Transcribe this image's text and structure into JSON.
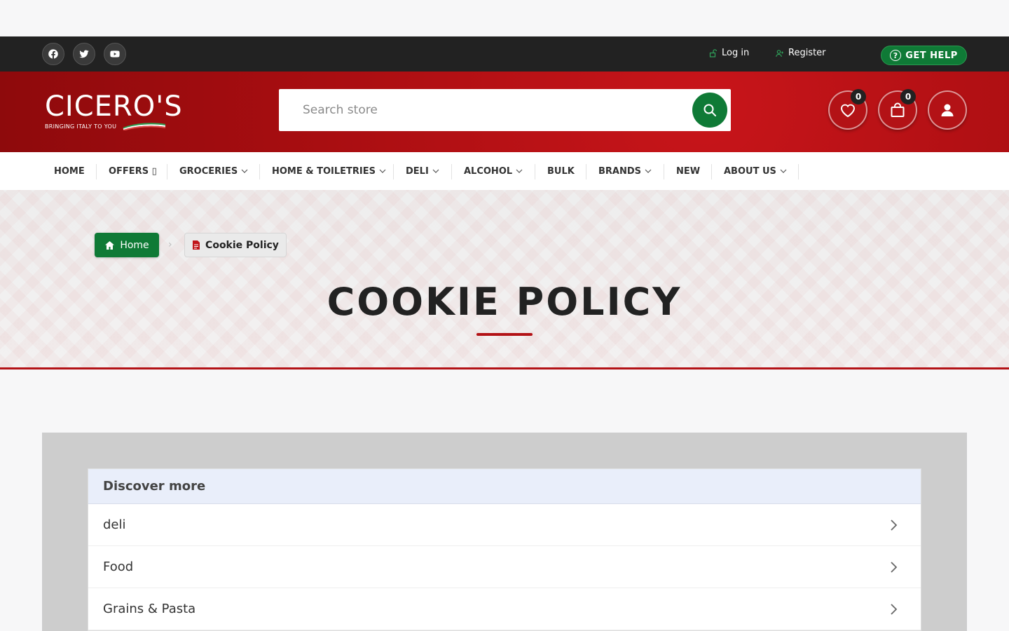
{
  "topbar": {
    "social": [
      "facebook-icon",
      "twitter-icon",
      "youtube-icon"
    ],
    "login_label": "Log in",
    "register_label": "Register",
    "help_label": "GET HELP"
  },
  "header": {
    "logo_text": "CICERO'S",
    "logo_tagline": "BRINGING ITALY TO YOU",
    "search_placeholder": "Search store",
    "wishlist_count": "0",
    "cart_count": "0"
  },
  "nav": {
    "items": [
      {
        "label": "HOME"
      },
      {
        "label": "OFFERS ▯"
      },
      {
        "label": "GROCERIES"
      },
      {
        "label": "HOME & TOILETRIES"
      },
      {
        "label": "DELI"
      },
      {
        "label": "ALCOHOL"
      },
      {
        "label": "BULK"
      },
      {
        "label": "BRANDS"
      },
      {
        "label": "NEW"
      },
      {
        "label": "ABOUT US"
      }
    ]
  },
  "breadcrumb": {
    "home_label": "Home",
    "current_label": "Cookie Policy"
  },
  "page": {
    "title": "COOKIE POLICY"
  },
  "discover": {
    "heading": "Discover more",
    "items": [
      "deli",
      "Food",
      "Grains & Pasta"
    ]
  },
  "colors": {
    "brand_red": "#b31216",
    "brand_green": "#0f7a36",
    "topbar_dark": "#222222"
  }
}
